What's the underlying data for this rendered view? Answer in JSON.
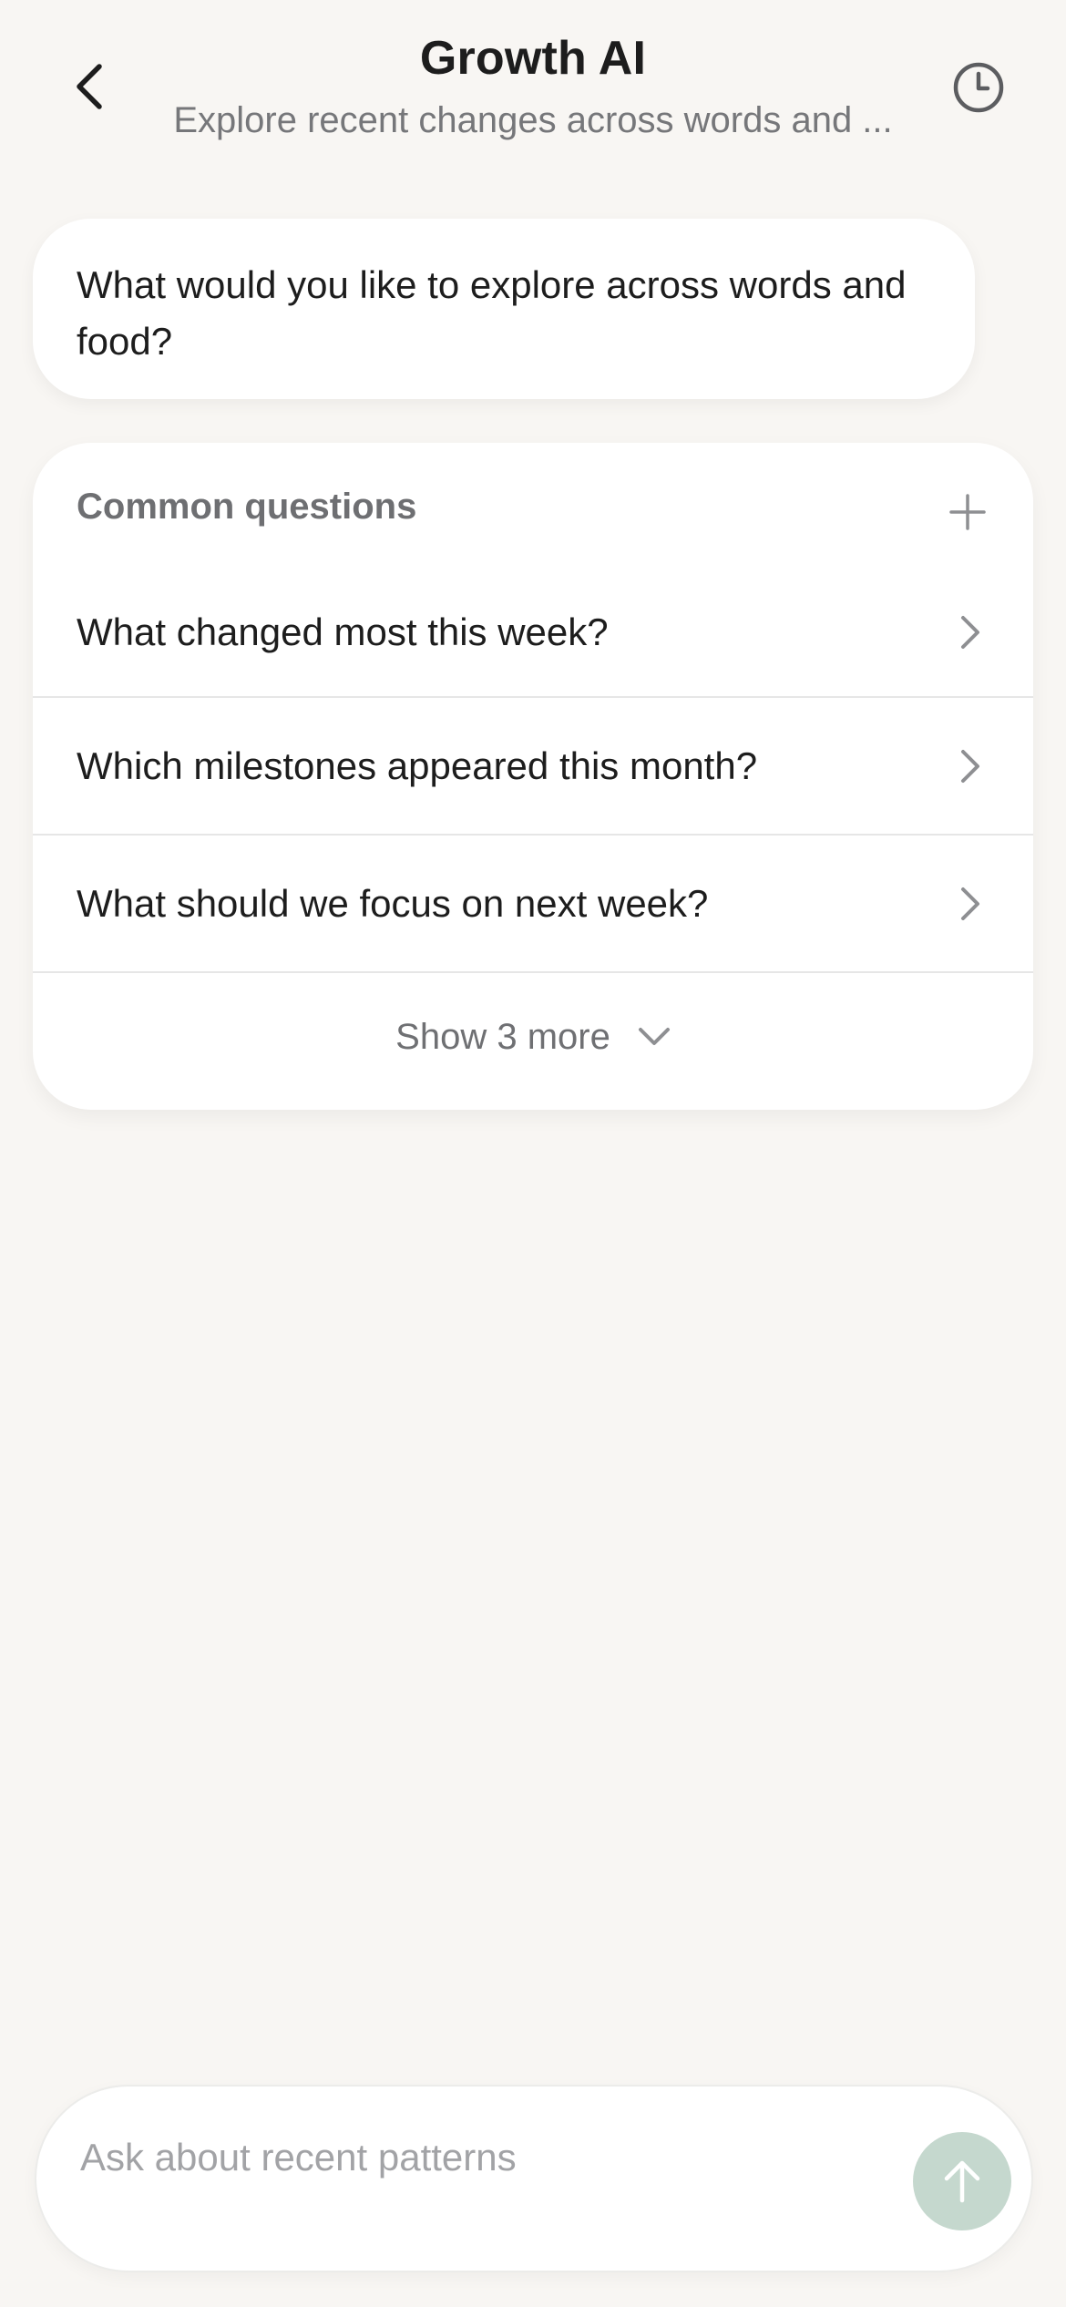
{
  "header": {
    "title": "Growth AI",
    "subtitle": "Explore recent changes across words and ...",
    "back_icon": "chevron-left-icon",
    "history_icon": "clock-icon"
  },
  "assistant": {
    "message": "What would you like to explore across words and food?"
  },
  "common_questions": {
    "title": "Common questions",
    "toggle_icon": "plus-icon",
    "items": [
      {
        "label": "What changed most this week?"
      },
      {
        "label": "Which milestones appeared this month?"
      },
      {
        "label": "What should we focus on next week?"
      }
    ],
    "show_more_label": "Show 3 more"
  },
  "composer": {
    "placeholder": "Ask about recent patterns",
    "value": "",
    "send_icon": "arrow-up-icon"
  },
  "colors": {
    "background": "#f8f6f3",
    "card": "#ffffff",
    "send_button": "#c5d8ce",
    "muted_text": "#76777a"
  }
}
